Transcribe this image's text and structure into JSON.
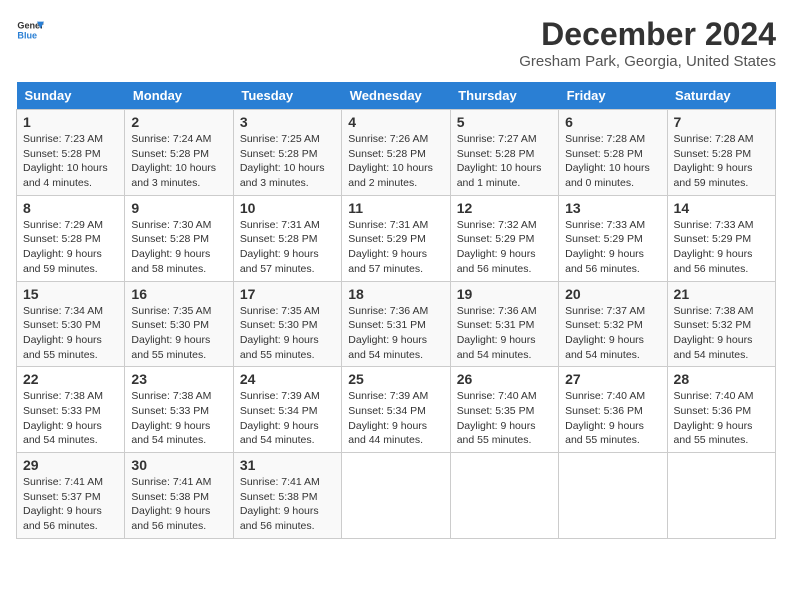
{
  "logo": {
    "line1": "General",
    "line2": "Blue"
  },
  "title": "December 2024",
  "location": "Gresham Park, Georgia, United States",
  "days_of_week": [
    "Sunday",
    "Monday",
    "Tuesday",
    "Wednesday",
    "Thursday",
    "Friday",
    "Saturday"
  ],
  "weeks": [
    [
      {
        "day": "1",
        "rise": "7:23 AM",
        "set": "5:28 PM",
        "daylight": "10 hours and 4 minutes."
      },
      {
        "day": "2",
        "rise": "7:24 AM",
        "set": "5:28 PM",
        "daylight": "10 hours and 3 minutes."
      },
      {
        "day": "3",
        "rise": "7:25 AM",
        "set": "5:28 PM",
        "daylight": "10 hours and 3 minutes."
      },
      {
        "day": "4",
        "rise": "7:26 AM",
        "set": "5:28 PM",
        "daylight": "10 hours and 2 minutes."
      },
      {
        "day": "5",
        "rise": "7:27 AM",
        "set": "5:28 PM",
        "daylight": "10 hours and 1 minute."
      },
      {
        "day": "6",
        "rise": "7:28 AM",
        "set": "5:28 PM",
        "daylight": "10 hours and 0 minutes."
      },
      {
        "day": "7",
        "rise": "7:28 AM",
        "set": "5:28 PM",
        "daylight": "9 hours and 59 minutes."
      }
    ],
    [
      {
        "day": "8",
        "rise": "7:29 AM",
        "set": "5:28 PM",
        "daylight": "9 hours and 59 minutes."
      },
      {
        "day": "9",
        "rise": "7:30 AM",
        "set": "5:28 PM",
        "daylight": "9 hours and 58 minutes."
      },
      {
        "day": "10",
        "rise": "7:31 AM",
        "set": "5:28 PM",
        "daylight": "9 hours and 57 minutes."
      },
      {
        "day": "11",
        "rise": "7:31 AM",
        "set": "5:29 PM",
        "daylight": "9 hours and 57 minutes."
      },
      {
        "day": "12",
        "rise": "7:32 AM",
        "set": "5:29 PM",
        "daylight": "9 hours and 56 minutes."
      },
      {
        "day": "13",
        "rise": "7:33 AM",
        "set": "5:29 PM",
        "daylight": "9 hours and 56 minutes."
      },
      {
        "day": "14",
        "rise": "7:33 AM",
        "set": "5:29 PM",
        "daylight": "9 hours and 56 minutes."
      }
    ],
    [
      {
        "day": "15",
        "rise": "7:34 AM",
        "set": "5:30 PM",
        "daylight": "9 hours and 55 minutes."
      },
      {
        "day": "16",
        "rise": "7:35 AM",
        "set": "5:30 PM",
        "daylight": "9 hours and 55 minutes."
      },
      {
        "day": "17",
        "rise": "7:35 AM",
        "set": "5:30 PM",
        "daylight": "9 hours and 55 minutes."
      },
      {
        "day": "18",
        "rise": "7:36 AM",
        "set": "5:31 PM",
        "daylight": "9 hours and 54 minutes."
      },
      {
        "day": "19",
        "rise": "7:36 AM",
        "set": "5:31 PM",
        "daylight": "9 hours and 54 minutes."
      },
      {
        "day": "20",
        "rise": "7:37 AM",
        "set": "5:32 PM",
        "daylight": "9 hours and 54 minutes."
      },
      {
        "day": "21",
        "rise": "7:38 AM",
        "set": "5:32 PM",
        "daylight": "9 hours and 54 minutes."
      }
    ],
    [
      {
        "day": "22",
        "rise": "7:38 AM",
        "set": "5:33 PM",
        "daylight": "9 hours and 54 minutes."
      },
      {
        "day": "23",
        "rise": "7:38 AM",
        "set": "5:33 PM",
        "daylight": "9 hours and 54 minutes."
      },
      {
        "day": "24",
        "rise": "7:39 AM",
        "set": "5:34 PM",
        "daylight": "9 hours and 54 minutes."
      },
      {
        "day": "25",
        "rise": "7:39 AM",
        "set": "5:34 PM",
        "daylight": "9 hours and 44 minutes."
      },
      {
        "day": "26",
        "rise": "7:40 AM",
        "set": "5:35 PM",
        "daylight": "9 hours and 55 minutes."
      },
      {
        "day": "27",
        "rise": "7:40 AM",
        "set": "5:36 PM",
        "daylight": "9 hours and 55 minutes."
      },
      {
        "day": "28",
        "rise": "7:40 AM",
        "set": "5:36 PM",
        "daylight": "9 hours and 55 minutes."
      }
    ],
    [
      {
        "day": "29",
        "rise": "7:41 AM",
        "set": "5:37 PM",
        "daylight": "9 hours and 56 minutes."
      },
      {
        "day": "30",
        "rise": "7:41 AM",
        "set": "5:38 PM",
        "daylight": "9 hours and 56 minutes."
      },
      {
        "day": "31",
        "rise": "7:41 AM",
        "set": "5:38 PM",
        "daylight": "9 hours and 56 minutes."
      },
      null,
      null,
      null,
      null
    ]
  ],
  "labels": {
    "sunrise": "Sunrise:",
    "sunset": "Sunset:",
    "daylight": "Daylight:"
  }
}
